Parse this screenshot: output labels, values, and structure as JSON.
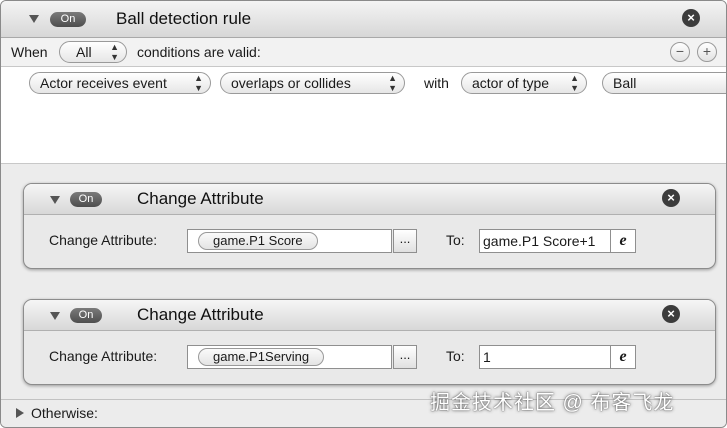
{
  "rule": {
    "toggle_label": "On",
    "title": "Ball detection rule"
  },
  "when_row": {
    "when_label": "When",
    "mode_value": "All",
    "suffix_label": "conditions are valid:",
    "remove_label": "−",
    "add_label": "+"
  },
  "condition": {
    "subject_value": "Actor receives event",
    "event_value": "overlaps or collides",
    "with_label": "with",
    "target_kind_value": "actor of type",
    "target_value": "Ball"
  },
  "actions": [
    {
      "toggle_label": "On",
      "title": "Change Attribute",
      "field_label": "Change Attribute:",
      "attribute_value": "game.P1 Score",
      "browse_label": "...",
      "to_label": "To:",
      "to_value": "game.P1 Score+1",
      "expr_label": "e"
    },
    {
      "toggle_label": "On",
      "title": "Change Attribute",
      "field_label": "Change Attribute:",
      "attribute_value": "game.P1Serving",
      "browse_label": "...",
      "to_label": "To:",
      "to_value": "1",
      "expr_label": "e"
    }
  ],
  "otherwise": {
    "label": "Otherwise:"
  },
  "watermark": "掘金技术社区 @ 布客飞龙",
  "icons": {
    "collapse": "triangle-down-icon",
    "close": "close-circle-icon",
    "popup": "updown-arrows-icon",
    "expand": "triangle-right-icon",
    "expression": "expression-e-icon"
  }
}
